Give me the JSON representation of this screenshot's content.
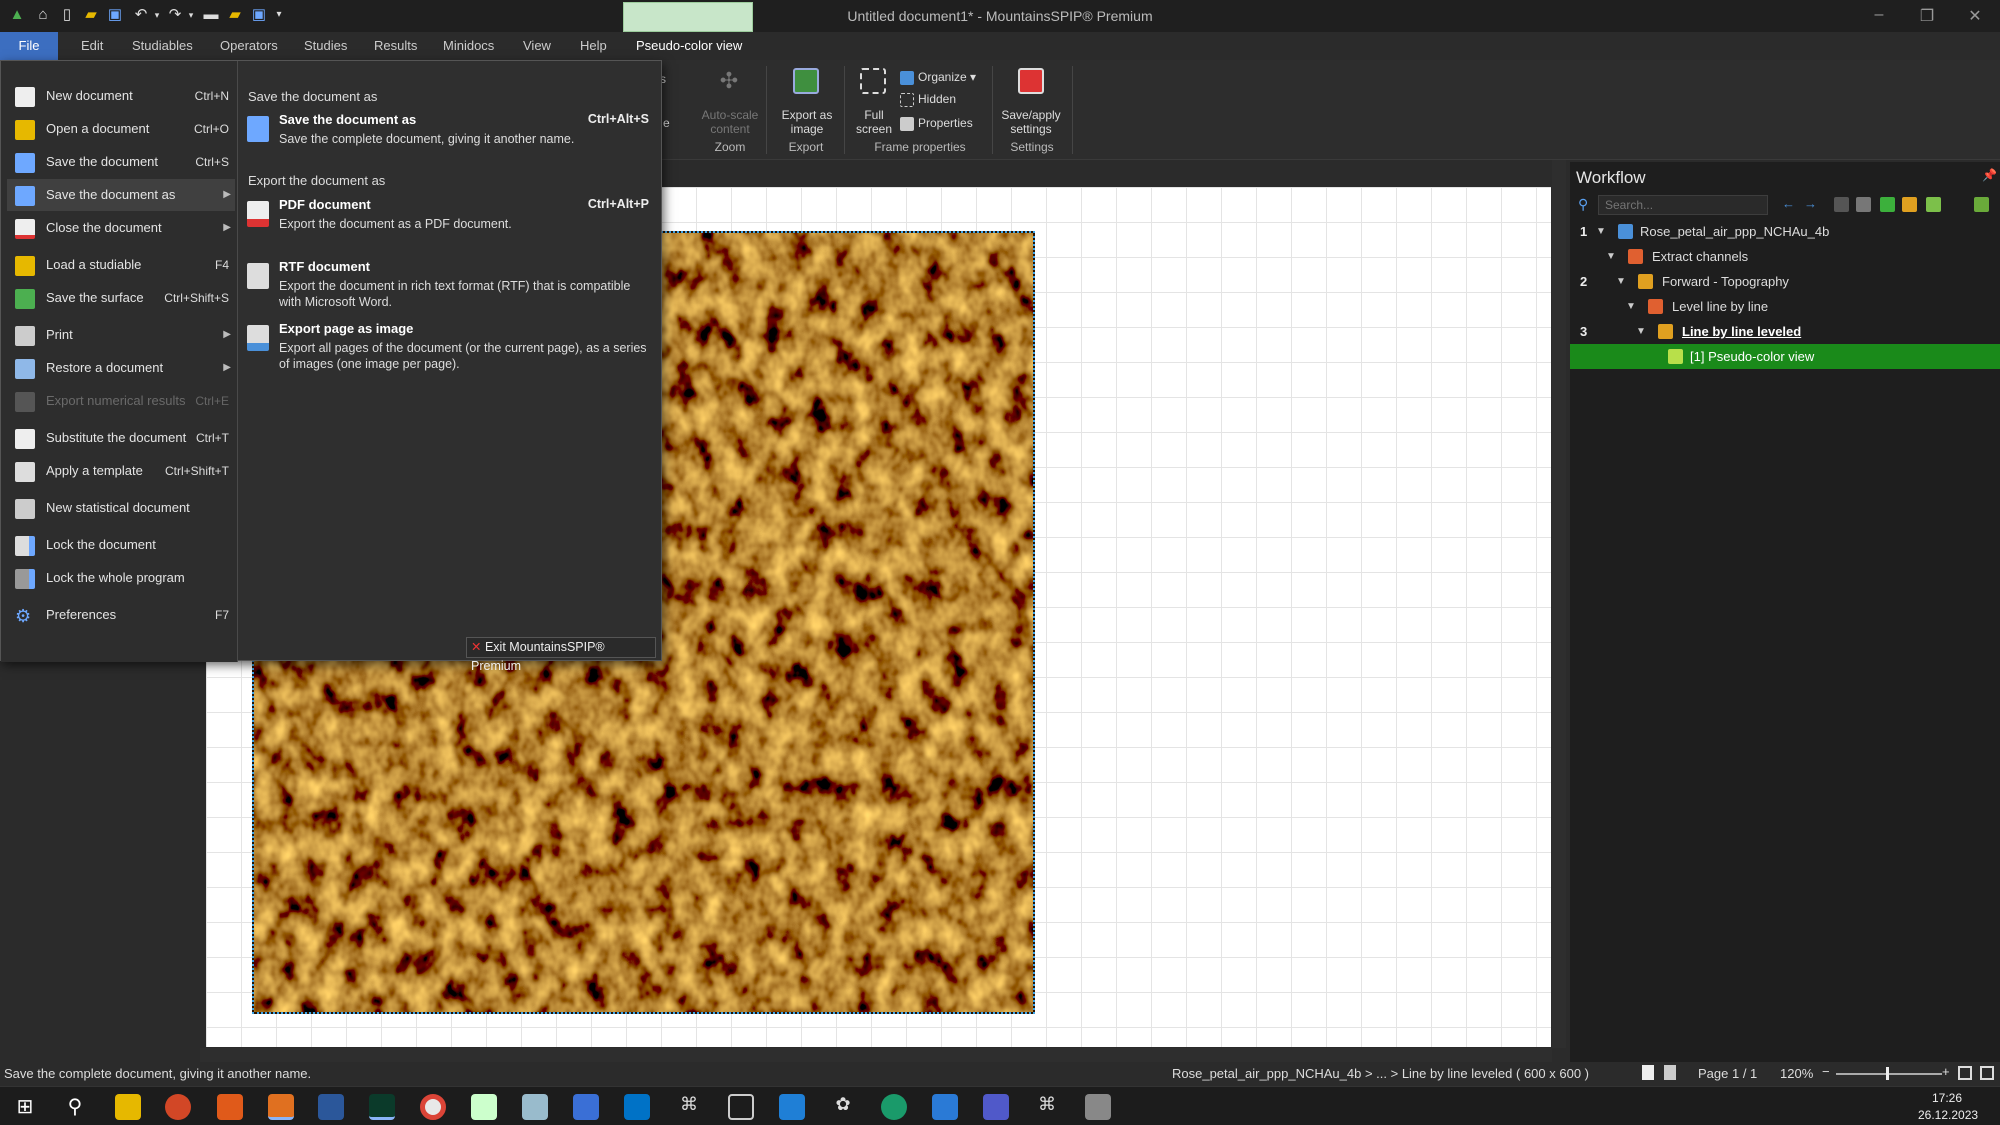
{
  "window": {
    "title": "Untitled document1* - MountainsSPIP® Premium"
  },
  "menubar": {
    "tabs": [
      "File",
      "Edit",
      "Studiables",
      "Operators",
      "Studies",
      "Results",
      "Minidocs",
      "View",
      "Help",
      "Pseudo-color view"
    ]
  },
  "ribbon": {
    "partial_left": "s",
    "partial_left2": "e",
    "autoscale_label": "Auto-scale content",
    "zoom_group": "Zoom",
    "export_image_label": "Export as image",
    "export_group": "Export",
    "fullscreen_label": "Full screen",
    "organize_label": "Organize",
    "hidden_label": "Hidden",
    "properties_label": "Properties",
    "frame_group": "Frame properties",
    "save_apply_label": "Save/apply settings",
    "settings_group": "Settings"
  },
  "file_menu": {
    "items": [
      {
        "label": "New document",
        "shortcut": "Ctrl+N",
        "icon": "new-document-icon"
      },
      {
        "label": "Open a document",
        "shortcut": "Ctrl+O",
        "icon": "open-folder-icon"
      },
      {
        "label": "Save the document",
        "shortcut": "Ctrl+S",
        "icon": "save-icon"
      },
      {
        "label": "Save the document as",
        "shortcut": "",
        "icon": "save-as-icon"
      },
      {
        "label": "Close the document",
        "shortcut": "",
        "icon": "close-document-icon"
      },
      {
        "label": "Load a studiable",
        "shortcut": "F4",
        "icon": "load-studiable-icon"
      },
      {
        "label": "Save the surface",
        "shortcut": "Ctrl+Shift+S",
        "icon": "save-surface-icon"
      },
      {
        "label": "Print",
        "shortcut": "",
        "icon": "print-icon"
      },
      {
        "label": "Restore a document",
        "shortcut": "",
        "icon": "restore-icon"
      },
      {
        "label": "Export numerical results",
        "shortcut": "Ctrl+E",
        "icon": "export-results-icon"
      },
      {
        "label": "Substitute the document",
        "shortcut": "Ctrl+T",
        "icon": "substitute-icon"
      },
      {
        "label": "Apply a template",
        "shortcut": "Ctrl+Shift+T",
        "icon": "template-icon"
      },
      {
        "label": "New statistical document",
        "shortcut": "",
        "icon": "statistics-icon"
      },
      {
        "label": "Lock the document",
        "shortcut": "",
        "icon": "lock-document-icon"
      },
      {
        "label": "Lock the whole program",
        "shortcut": "",
        "icon": "lock-program-icon"
      },
      {
        "label": "Preferences",
        "shortcut": "F7",
        "icon": "gear-icon"
      }
    ],
    "submenu": {
      "heading_save": "Save the document as",
      "save_as": {
        "title": "Save the document as",
        "shortcut": "Ctrl+Alt+S",
        "desc": "Save the complete document, giving it another name."
      },
      "heading_export": "Export the document as",
      "pdf": {
        "title": "PDF document",
        "shortcut": "Ctrl+Alt+P",
        "desc": "Export the document as a PDF document."
      },
      "rtf": {
        "title": "RTF document",
        "desc": "Export the document in rich text format (RTF) that is compatible with Microsoft Word."
      },
      "image": {
        "title": "Export page as image",
        "desc": "Export all pages of the document (or the current page), as a series of images (one image per page)."
      }
    },
    "exit_label": "Exit MountainsSPIP® Premium"
  },
  "workflow": {
    "title": "Workflow",
    "search_placeholder": "Search...",
    "rows": [
      {
        "num": "1",
        "label": "Rose_petal_air_ppp_NCHAu_4b"
      },
      {
        "num": "",
        "label": "Extract channels"
      },
      {
        "num": "2",
        "label": "Forward - Topography"
      },
      {
        "num": "",
        "label": "Level line by line"
      },
      {
        "num": "3",
        "label": "Line by line leveled"
      },
      {
        "num": "",
        "label": "[1] Pseudo-color view"
      }
    ]
  },
  "statusbar": {
    "message": "Save the complete document, giving it another name.",
    "path": "Rose_petal_air_ppp_NCHAu_4b > ... > Line by line leveled ( 600 x 600 )",
    "page": "Page 1 / 1",
    "zoom": "120%"
  },
  "taskbar": {
    "time": "17:26",
    "date": "26.12.2023"
  }
}
